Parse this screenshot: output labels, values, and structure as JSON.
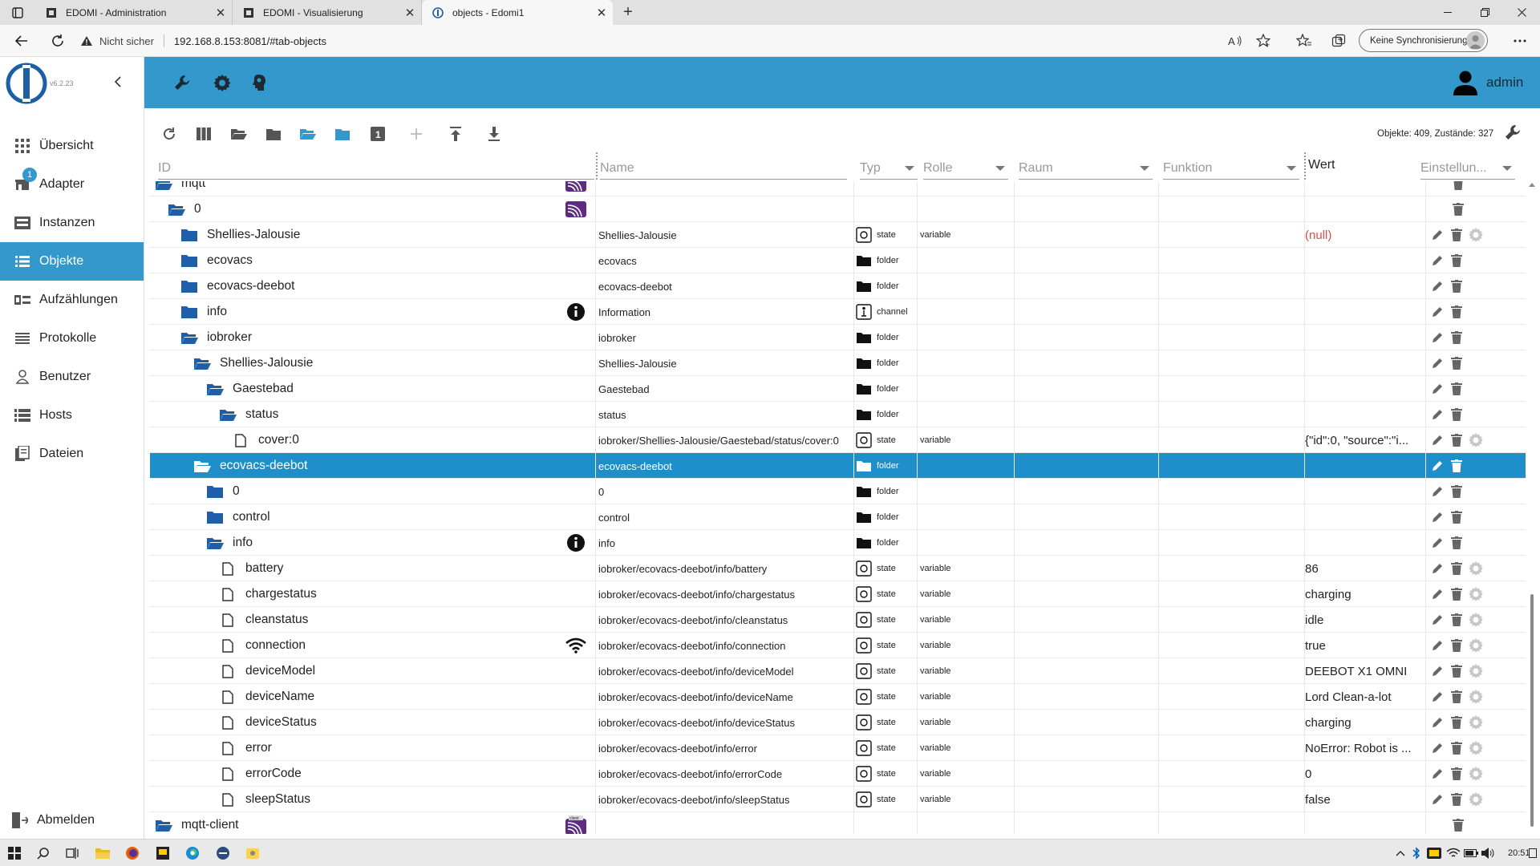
{
  "browser": {
    "tabs": [
      {
        "label": "EDOMI - Administration",
        "icon": "edomi-icon"
      },
      {
        "label": "EDOMI - Visualisierung",
        "icon": "edomi-icon"
      },
      {
        "label": "objects - Edomi1",
        "icon": "iobroker-icon"
      }
    ],
    "address": {
      "security_label": "Nicht sicher",
      "url": "192.168.8.153:8081/#tab-objects"
    },
    "sync_label": "Keine Synchronisierung"
  },
  "app": {
    "version": "v6.2.23",
    "accent": "#3399cc",
    "selected_row": "#1f8fcb",
    "null_color": "#e64b4b"
  },
  "sidebar": {
    "items": [
      {
        "label": "Übersicht",
        "icon": "grid-icon"
      },
      {
        "label": "Adapter",
        "icon": "store-icon",
        "badge": "1"
      },
      {
        "label": "Instanzen",
        "icon": "instances-icon"
      },
      {
        "label": "Objekte",
        "icon": "list-icon",
        "active": true
      },
      {
        "label": "Aufzählungen",
        "icon": "enum-icon"
      },
      {
        "label": "Protokolle",
        "icon": "lines-icon"
      },
      {
        "label": "Benutzer",
        "icon": "user-icon"
      },
      {
        "label": "Hosts",
        "icon": "hosts-icon"
      },
      {
        "label": "Dateien",
        "icon": "files-icon"
      }
    ],
    "logout_label": "Abmelden"
  },
  "topbar": {
    "username": "admin"
  },
  "toolbar": {
    "objects_count": "Objekte: 409, Zustände: 327"
  },
  "columns": {
    "id": "ID",
    "name": "Name",
    "type": "Typ",
    "role": "Rolle",
    "room": "Raum",
    "function": "Funktion",
    "value": "Wert",
    "settings": "Einstellun..."
  },
  "rows": [
    {
      "id": "mqtt",
      "name": "",
      "type": "",
      "role": "",
      "value": "",
      "icon": "folder-open",
      "level": 0,
      "right_icon": "mqtt-logo",
      "actions": "delete"
    },
    {
      "id": "0",
      "name": "",
      "type": "",
      "role": "",
      "value": "",
      "icon": "folder-open",
      "level": 1,
      "right_icon": "mqtt-logo",
      "actions": "delete"
    },
    {
      "id": "Shellies-Jalousie",
      "name": "Shellies-Jalousie",
      "type": "state",
      "role": "variable",
      "value": "(null)",
      "icon": "folder",
      "level": 2,
      "actions": "full"
    },
    {
      "id": "ecovacs",
      "name": "ecovacs",
      "type": "folder",
      "role": "",
      "value": "",
      "icon": "folder",
      "level": 2,
      "actions": "edit-delete"
    },
    {
      "id": "ecovacs-deebot",
      "name": "ecovacs-deebot",
      "type": "folder",
      "role": "",
      "value": "",
      "icon": "folder",
      "level": 2,
      "actions": "edit-delete"
    },
    {
      "id": "info",
      "name": "Information",
      "type": "channel",
      "role": "",
      "value": "",
      "icon": "folder",
      "level": 2,
      "right_icon": "info-icon",
      "actions": "edit-delete"
    },
    {
      "id": "iobroker",
      "name": "iobroker",
      "type": "folder",
      "role": "",
      "value": "",
      "icon": "folder-open",
      "level": 2,
      "actions": "edit-delete"
    },
    {
      "id": "Shellies-Jalousie",
      "name": "Shellies-Jalousie",
      "type": "folder",
      "role": "",
      "value": "",
      "icon": "folder-open",
      "level": 3,
      "actions": "edit-delete"
    },
    {
      "id": "Gaestebad",
      "name": "Gaestebad",
      "type": "folder",
      "role": "",
      "value": "",
      "icon": "folder-open",
      "level": 4,
      "actions": "edit-delete"
    },
    {
      "id": "status",
      "name": "status",
      "type": "folder",
      "role": "",
      "value": "",
      "icon": "folder-open",
      "level": 5,
      "actions": "edit-delete"
    },
    {
      "id": "cover:0",
      "name": "iobroker/Shellies-Jalousie/Gaestebad/status/cover:0",
      "type": "state",
      "role": "variable",
      "value": "{\"id\":0, \"source\":\"i...",
      "icon": "file",
      "level": 6,
      "actions": "full"
    },
    {
      "id": "ecovacs-deebot",
      "name": "ecovacs-deebot",
      "type": "folder",
      "role": "",
      "value": "",
      "icon": "folder-open",
      "level": 3,
      "selected": true,
      "actions": "edit-delete"
    },
    {
      "id": "0",
      "name": "0",
      "type": "folder",
      "role": "",
      "value": "",
      "icon": "folder",
      "level": 4,
      "actions": "edit-delete"
    },
    {
      "id": "control",
      "name": "control",
      "type": "folder",
      "role": "",
      "value": "",
      "icon": "folder",
      "level": 4,
      "actions": "edit-delete"
    },
    {
      "id": "info",
      "name": "info",
      "type": "folder",
      "role": "",
      "value": "",
      "icon": "folder-open",
      "level": 4,
      "right_icon": "info-icon",
      "actions": "edit-delete"
    },
    {
      "id": "battery",
      "name": "iobroker/ecovacs-deebot/info/battery",
      "type": "state",
      "role": "variable",
      "value": "86",
      "icon": "file",
      "level": 5,
      "actions": "full"
    },
    {
      "id": "chargestatus",
      "name": "iobroker/ecovacs-deebot/info/chargestatus",
      "type": "state",
      "role": "variable",
      "value": "charging",
      "icon": "file",
      "level": 5,
      "actions": "full"
    },
    {
      "id": "cleanstatus",
      "name": "iobroker/ecovacs-deebot/info/cleanstatus",
      "type": "state",
      "role": "variable",
      "value": "idle",
      "icon": "file",
      "level": 5,
      "actions": "full"
    },
    {
      "id": "connection",
      "name": "iobroker/ecovacs-deebot/info/connection",
      "type": "state",
      "role": "variable",
      "value": "true",
      "icon": "file",
      "level": 5,
      "right_icon": "wifi-icon",
      "actions": "full"
    },
    {
      "id": "deviceModel",
      "name": "iobroker/ecovacs-deebot/info/deviceModel",
      "type": "state",
      "role": "variable",
      "value": "DEEBOT X1 OMNI",
      "icon": "file",
      "level": 5,
      "actions": "full"
    },
    {
      "id": "deviceName",
      "name": "iobroker/ecovacs-deebot/info/deviceName",
      "type": "state",
      "role": "variable",
      "value": "Lord Clean-a-lot",
      "icon": "file",
      "level": 5,
      "actions": "full"
    },
    {
      "id": "deviceStatus",
      "name": "iobroker/ecovacs-deebot/info/deviceStatus",
      "type": "state",
      "role": "variable",
      "value": "charging",
      "icon": "file",
      "level": 5,
      "actions": "full"
    },
    {
      "id": "error",
      "name": "iobroker/ecovacs-deebot/info/error",
      "type": "state",
      "role": "variable",
      "value": "NoError: Robot is ...",
      "icon": "file",
      "level": 5,
      "actions": "full"
    },
    {
      "id": "errorCode",
      "name": "iobroker/ecovacs-deebot/info/errorCode",
      "type": "state",
      "role": "variable",
      "value": "0",
      "icon": "file",
      "level": 5,
      "actions": "full"
    },
    {
      "id": "sleepStatus",
      "name": "iobroker/ecovacs-deebot/info/sleepStatus",
      "type": "state",
      "role": "variable",
      "value": "false",
      "icon": "file",
      "level": 5,
      "actions": "full"
    },
    {
      "id": "mqtt-client",
      "name": "",
      "type": "",
      "role": "",
      "value": "",
      "icon": "folder-open",
      "level": 0,
      "right_icon": "mqtt-client-logo",
      "actions": "delete"
    }
  ],
  "taskbar": {
    "time": "20:51"
  }
}
